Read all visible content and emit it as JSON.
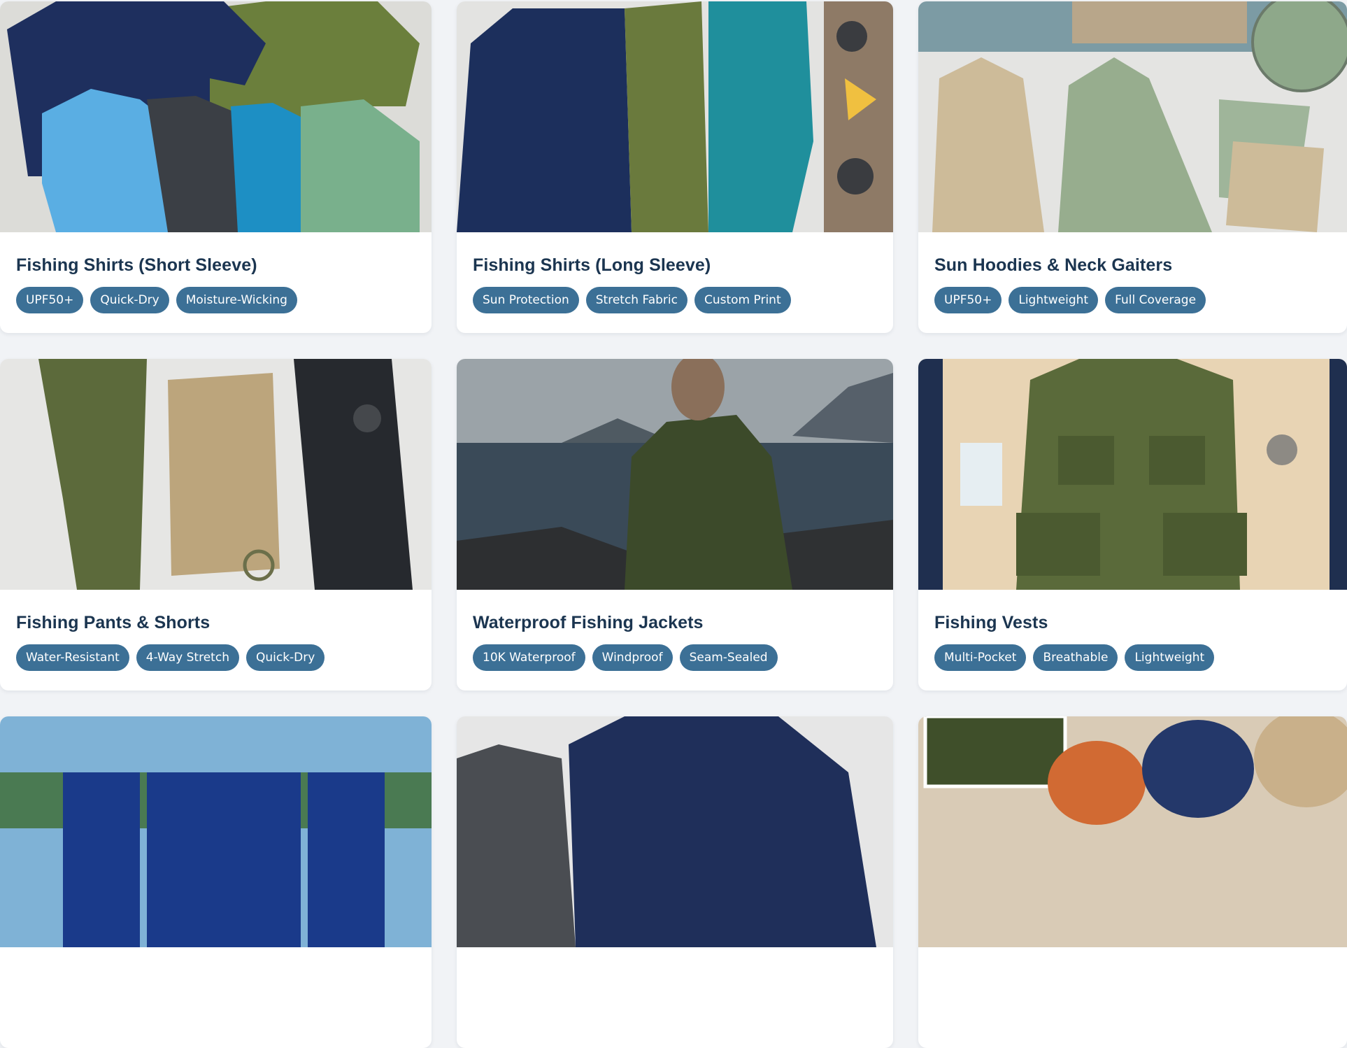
{
  "colors": {
    "page_bg": "#f1f3f6",
    "card_bg": "#ffffff",
    "title": "#1b3550",
    "tag_bg": "#3c7096",
    "tag_text": "#ffffff"
  },
  "categories": [
    {
      "title": "Fishing Shirts (Short Sleeve)",
      "tags": [
        "UPF50+",
        "Quick-Dry",
        "Moisture-Wicking"
      ],
      "image": "short-sleeve-shirts-photo"
    },
    {
      "title": "Fishing Shirts (Long Sleeve)",
      "tags": [
        "Sun Protection",
        "Stretch Fabric",
        "Custom Print"
      ],
      "image": "long-sleeve-shirts-photo"
    },
    {
      "title": "Sun Hoodies & Neck Gaiters",
      "tags": [
        "UPF50+",
        "Lightweight",
        "Full Coverage"
      ],
      "image": "sun-hoodies-photo"
    },
    {
      "title": "Fishing Pants & Shorts",
      "tags": [
        "Water-Resistant",
        "4-Way Stretch",
        "Quick-Dry"
      ],
      "image": "pants-shorts-photo"
    },
    {
      "title": "Waterproof Fishing Jackets",
      "tags": [
        "10K Waterproof",
        "Windproof",
        "Seam-Sealed"
      ],
      "image": "jacket-photo"
    },
    {
      "title": "Fishing Vests",
      "tags": [
        "Multi-Pocket",
        "Breathable",
        "Lightweight"
      ],
      "image": "vest-photo"
    },
    {
      "title": "",
      "tags": [],
      "image": "team-jerseys-photo"
    },
    {
      "title": "",
      "tags": [],
      "image": "base-layers-photo"
    },
    {
      "title": "",
      "tags": [],
      "image": "hats-caps-photo"
    }
  ]
}
